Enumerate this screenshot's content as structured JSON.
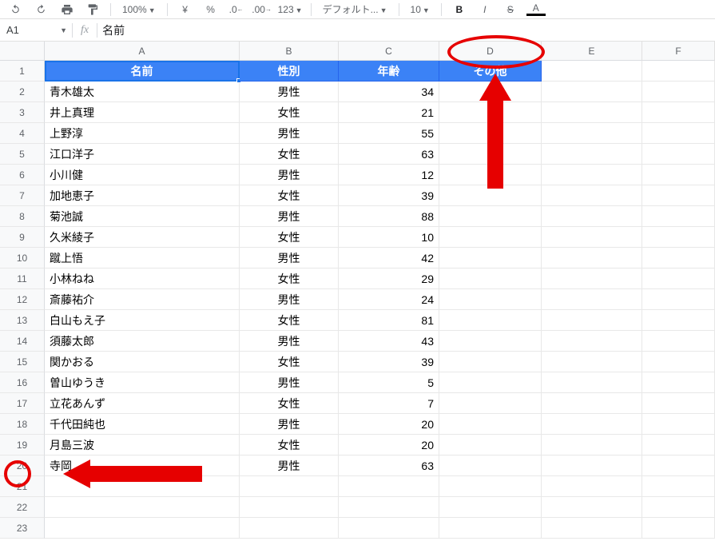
{
  "toolbar": {
    "zoom": "100%",
    "font": "デフォルト...",
    "fontsize": "10",
    "bold": "B",
    "italic": "I",
    "strike": "S",
    "textcolor": "A"
  },
  "namebox": {
    "ref": "A1"
  },
  "formula": {
    "fx": "fx",
    "value": "名前"
  },
  "columns": [
    "A",
    "B",
    "C",
    "D",
    "E",
    "F"
  ],
  "headers": {
    "name": "名前",
    "gender": "性別",
    "age": "年齢",
    "other": "その他"
  },
  "rows": [
    {
      "r": 1
    },
    {
      "r": 2,
      "name": "青木雄太",
      "gender": "男性",
      "age": 34
    },
    {
      "r": 3,
      "name": "井上真理",
      "gender": "女性",
      "age": 21
    },
    {
      "r": 4,
      "name": "上野淳",
      "gender": "男性",
      "age": 55
    },
    {
      "r": 5,
      "name": "江口洋子",
      "gender": "女性",
      "age": 63
    },
    {
      "r": 6,
      "name": "小川健",
      "gender": "男性",
      "age": 12
    },
    {
      "r": 7,
      "name": "加地恵子",
      "gender": "女性",
      "age": 39
    },
    {
      "r": 8,
      "name": "菊池誠",
      "gender": "男性",
      "age": 88
    },
    {
      "r": 9,
      "name": "久米綾子",
      "gender": "女性",
      "age": 10
    },
    {
      "r": 10,
      "name": "蹴上悟",
      "gender": "男性",
      "age": 42
    },
    {
      "r": 11,
      "name": "小林ねね",
      "gender": "女性",
      "age": 29
    },
    {
      "r": 12,
      "name": "斎藤祐介",
      "gender": "男性",
      "age": 24
    },
    {
      "r": 13,
      "name": "白山もえ子",
      "gender": "女性",
      "age": 81
    },
    {
      "r": 14,
      "name": "須藤太郎",
      "gender": "男性",
      "age": 43
    },
    {
      "r": 15,
      "name": "関かおる",
      "gender": "女性",
      "age": 39
    },
    {
      "r": 16,
      "name": "曽山ゆうき",
      "gender": "男性",
      "age": 5
    },
    {
      "r": 17,
      "name": "立花あんず",
      "gender": "女性",
      "age": 7
    },
    {
      "r": 18,
      "name": "千代田純也",
      "gender": "男性",
      "age": 20
    },
    {
      "r": 19,
      "name": "月島三波",
      "gender": "女性",
      "age": 20
    },
    {
      "r": 20,
      "name": "寺岡",
      "gender": "男性",
      "age": 63
    },
    {
      "r": 21
    },
    {
      "r": 22
    },
    {
      "r": 23
    }
  ]
}
